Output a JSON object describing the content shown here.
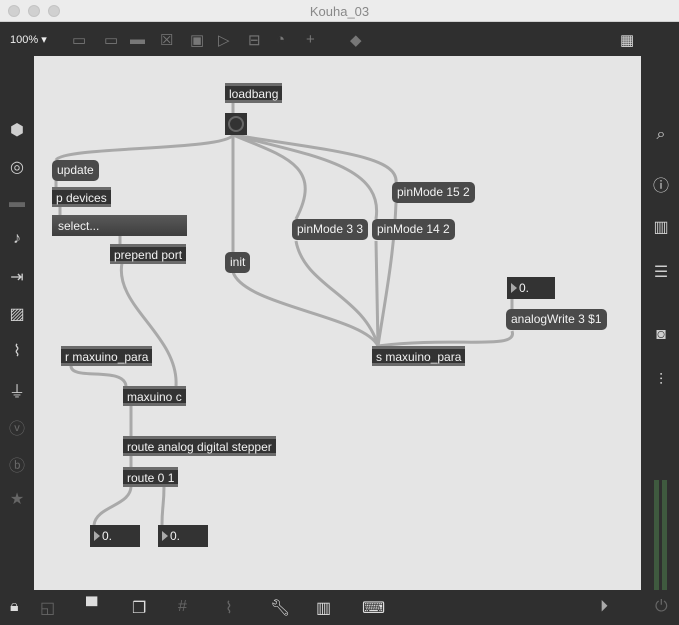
{
  "window": {
    "title": "Kouha_03"
  },
  "toolbar": {
    "zoom": "100%"
  },
  "patch": {
    "loadbang": "loadbang",
    "update": "update",
    "p_devices": "p devices",
    "umenu": "select...",
    "prepend": "prepend port",
    "init": "init",
    "pin33": "pinMode 3 3",
    "pin142": "pinMode 14 2",
    "pin152": "pinMode 15 2",
    "num_top": "0.",
    "analogwrite": "analogWrite 3 $1",
    "send": "s maxuino_para",
    "receive": "r maxuino_para",
    "maxuino": "maxuino c",
    "route1": "route analog digital stepper",
    "route2": "route 0 1",
    "num_left": "0.",
    "num_right": "0."
  }
}
